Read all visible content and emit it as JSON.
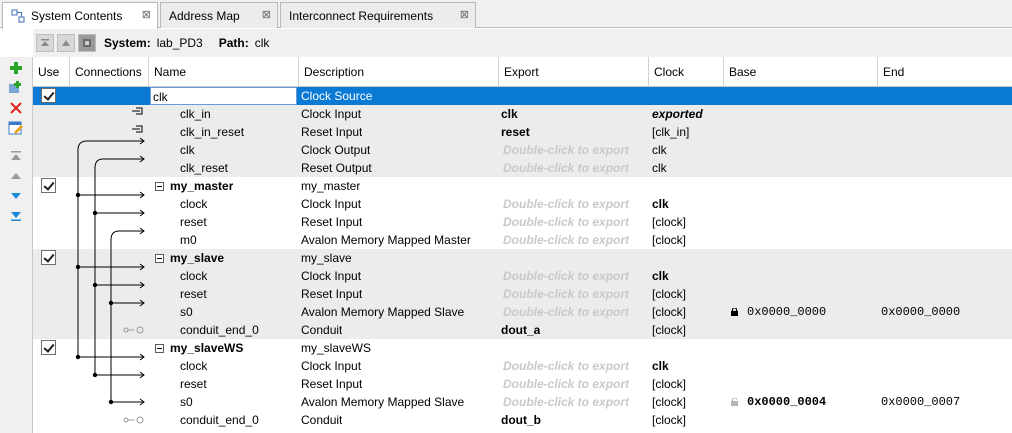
{
  "tabs": [
    {
      "label": "System Contents",
      "active": true
    },
    {
      "label": "Address Map",
      "active": false
    },
    {
      "label": "Interconnect Requirements",
      "active": false
    }
  ],
  "sysbar": {
    "system_label": "System:",
    "system_value": "lab_PD3",
    "path_label": "Path:",
    "path_value": "clk"
  },
  "columns": [
    "Use",
    "Connections",
    "Name",
    "Description",
    "Export",
    "Clock",
    "Base",
    "End"
  ],
  "rows": [
    {
      "name": "clk",
      "desc": "Clock Source",
      "export": "",
      "clock": "",
      "base": "",
      "end": ""
    },
    {
      "name": "clk_in",
      "desc": "Clock Input",
      "export": "clk",
      "clock": "exported",
      "base": "",
      "end": ""
    },
    {
      "name": "clk_in_reset",
      "desc": "Reset Input",
      "export": "reset",
      "clock": "[clk_in]",
      "base": "",
      "end": ""
    },
    {
      "name": "clk",
      "desc": "Clock Output",
      "export": "Double-click to export",
      "clock": "clk",
      "base": "",
      "end": ""
    },
    {
      "name": "clk_reset",
      "desc": "Reset Output",
      "export": "Double-click to export",
      "clock": "clk",
      "base": "",
      "end": ""
    },
    {
      "name": "my_master",
      "desc": "my_master",
      "export": "",
      "clock": "",
      "base": "",
      "end": ""
    },
    {
      "name": "clock",
      "desc": "Clock Input",
      "export": "Double-click to export",
      "clock": "clk",
      "base": "",
      "end": ""
    },
    {
      "name": "reset",
      "desc": "Reset Input",
      "export": "Double-click to export",
      "clock": "[clock]",
      "base": "",
      "end": ""
    },
    {
      "name": "m0",
      "desc": "Avalon Memory Mapped Master",
      "export": "Double-click to export",
      "clock": "[clock]",
      "base": "",
      "end": ""
    },
    {
      "name": "my_slave",
      "desc": "my_slave",
      "export": "",
      "clock": "",
      "base": "",
      "end": ""
    },
    {
      "name": "clock",
      "desc": "Clock Input",
      "export": "Double-click to export",
      "clock": "clk",
      "base": "",
      "end": ""
    },
    {
      "name": "reset",
      "desc": "Reset Input",
      "export": "Double-click to export",
      "clock": "[clock]",
      "base": "",
      "end": ""
    },
    {
      "name": "s0",
      "desc": "Avalon Memory Mapped Slave",
      "export": "Double-click to export",
      "clock": "[clock]",
      "base": "0x0000_0000",
      "end": "0x0000_0000"
    },
    {
      "name": "conduit_end_0",
      "desc": "Conduit",
      "export": "dout_a",
      "clock": "[clock]",
      "base": "",
      "end": ""
    },
    {
      "name": "my_slaveWS",
      "desc": "my_slaveWS",
      "export": "",
      "clock": "",
      "base": "",
      "end": ""
    },
    {
      "name": "clock",
      "desc": "Clock Input",
      "export": "Double-click to export",
      "clock": "clk",
      "base": "",
      "end": ""
    },
    {
      "name": "reset",
      "desc": "Reset Input",
      "export": "Double-click to export",
      "clock": "[clock]",
      "base": "",
      "end": ""
    },
    {
      "name": "s0",
      "desc": "Avalon Memory Mapped Slave",
      "export": "Double-click to export",
      "clock": "[clock]",
      "base": "0x0000_0004",
      "end": "0x0000_0007"
    },
    {
      "name": "conduit_end_0",
      "desc": "Conduit",
      "export": "dout_b",
      "clock": "[clock]",
      "base": "",
      "end": ""
    }
  ],
  "colors": {
    "selection": "#0a7ad5",
    "shade": "#ececec",
    "dim_text": "#c9c9c9"
  },
  "icons": [
    "system-contents-icon",
    "tab-close-icon",
    "move-top-icon",
    "move-up-icon",
    "system-icon",
    "add-component-icon",
    "add-instance-icon",
    "remove-icon",
    "edit-icon",
    "move-top-icon",
    "move-up-icon",
    "move-down-icon",
    "move-bottom-icon",
    "lock-icon"
  ]
}
